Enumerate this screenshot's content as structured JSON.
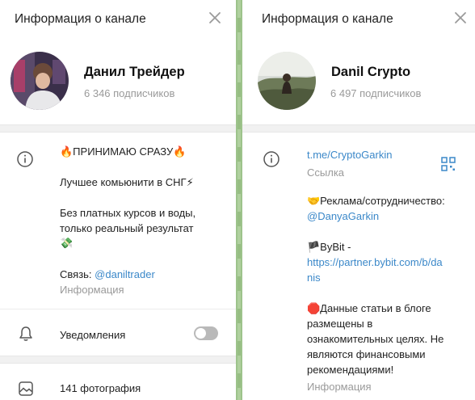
{
  "left": {
    "header": {
      "title": "Информация о канале"
    },
    "channel": {
      "name": "Данил Трейдер",
      "subscribers": "6 346 подписчиков"
    },
    "about": {
      "line1": "🔥ПРИНИМАЮ СРАЗУ🔥",
      "line2": "Лучшее комьюнити в СНГ⚡",
      "line3": "Без платных курсов и воды,",
      "line4": "только реальный результат",
      "line5": "💸",
      "contact_prefix": "Связь: ",
      "contact_link": "@daniltrader",
      "caption": "Информация"
    },
    "notifications": {
      "label": "Уведомления",
      "enabled": false
    },
    "media": {
      "photos_label": "141 фотография"
    }
  },
  "right": {
    "header": {
      "title": "Информация о канале"
    },
    "channel": {
      "name": "Danil Crypto",
      "subscribers": "6 497 подписчиков"
    },
    "link": {
      "url": "t.me/CryptoGarkin",
      "caption": "Ссылка"
    },
    "about": {
      "ad_line": "🤝Реклама/сотрудничество:",
      "ad_link": "@DanyaGarkin",
      "bybit_line": "🏴ByBit -",
      "bybit_link1": "https://partner.bybit.com/b/da",
      "bybit_link2": "nis",
      "disc1": "🛑Данные статьи в блоге",
      "disc2": "размещены в",
      "disc3": "ознакомительных целях. Не",
      "disc4": "являются финансовыми",
      "disc5": "рекомендациями!",
      "caption": "Информация"
    }
  },
  "colors": {
    "accent": "#3b88c9",
    "muted": "#9a9a9a",
    "separator": "#f1f1f1",
    "chat_strip": "#9dc38b"
  }
}
